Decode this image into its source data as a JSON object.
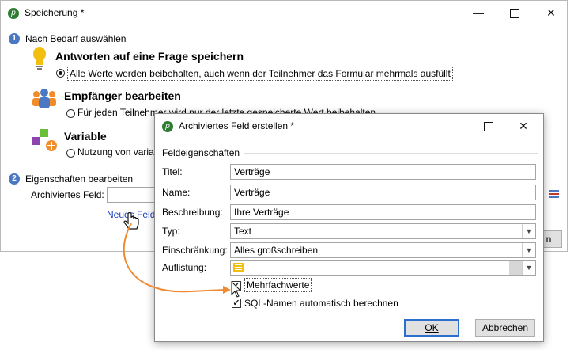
{
  "main_window": {
    "title": "Speicherung *",
    "section1_label": "Nach Bedarf auswählen",
    "section1_num": "1",
    "option1": {
      "heading": "Antworten auf eine Frage speichern",
      "radio_label": "Alle Werte werden beibehalten, auch wenn der Teilnehmer das Formular mehrmals ausfüllt",
      "selected": true,
      "icon": "lightbulb-icon"
    },
    "option2": {
      "heading": "Empfänger bearbeiten",
      "radio_label": "Für jeden Teilnehmer wird nur der letzte gespeicherte Wert beibehalten",
      "selected": false,
      "icon": "recipients-icon"
    },
    "option3": {
      "heading": "Variable",
      "radio_label": "Nutzung von variablen",
      "selected": false,
      "icon": "variable-icon"
    },
    "section2_num": "2",
    "section2_label": "Eigenschaften bearbeiten",
    "archived_field_label": "Archiviertes Feld:",
    "archived_field_value": "",
    "new_field_link": "Neues Feld...",
    "partial_button_label": "n"
  },
  "dialog": {
    "title": "Archiviertes Feld erstellen *",
    "group_label": "Feldeigenschaften",
    "fields": {
      "title_label": "Titel:",
      "title_value": "Verträge",
      "name_label": "Name:",
      "name_value": "Verträge",
      "description_label": "Beschreibung:",
      "description_value": "Ihre Verträge",
      "type_label": "Typ:",
      "type_value": "Text",
      "restriction_label": "Einschränkung:",
      "restriction_value": "Alles großschreiben",
      "enumeration_label": "Auflistung:",
      "enumeration_value": ""
    },
    "checkboxes": [
      {
        "label": "Mehrfachwerte",
        "checked": true
      },
      {
        "label": "SQL-Namen automatisch berechnen",
        "checked": true
      }
    ],
    "ok_label": "OK",
    "cancel_label": "Abbrechen"
  },
  "colors": {
    "accent": "#4a78c2",
    "arrow": "#ef8a32",
    "link": "#1a3fbf",
    "bulb": "#f2bf10"
  }
}
